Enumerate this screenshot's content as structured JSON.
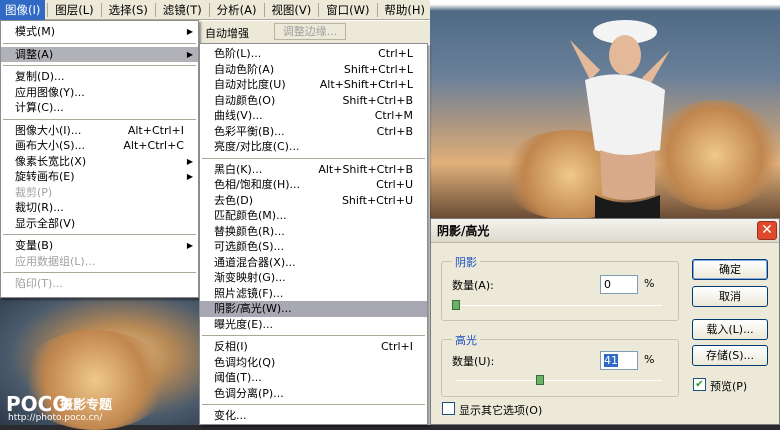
{
  "menubar": {
    "items": [
      "图像(I)",
      "图层(L)",
      "选择(S)",
      "滤镜(T)",
      "分析(A)",
      "视图(V)",
      "窗口(W)",
      "帮助(H)"
    ]
  },
  "image_menu": {
    "items": [
      {
        "label": "模式(M)",
        "shortcut": "",
        "sub": true
      },
      {
        "label": "调整(A)",
        "shortcut": "",
        "sub": true
      },
      {
        "label": "复制(D)...",
        "shortcut": ""
      },
      {
        "label": "应用图像(Y)...",
        "shortcut": ""
      },
      {
        "label": "计算(C)...",
        "shortcut": ""
      },
      {
        "label": "图像大小(I)...",
        "shortcut": "Alt+Ctrl+I"
      },
      {
        "label": "画布大小(S)...",
        "shortcut": "Alt+Ctrl+C"
      },
      {
        "label": "像素长宽比(X)",
        "shortcut": "",
        "sub": true
      },
      {
        "label": "旋转画布(E)",
        "shortcut": "",
        "sub": true
      },
      {
        "label": "裁剪(P)",
        "shortcut": ""
      },
      {
        "label": "裁切(R)...",
        "shortcut": ""
      },
      {
        "label": "显示全部(V)",
        "shortcut": ""
      },
      {
        "label": "变量(B)",
        "shortcut": "",
        "sub": true
      },
      {
        "label": "应用数据组(L)...",
        "shortcut": ""
      },
      {
        "label": "陷印(T)...",
        "shortcut": ""
      }
    ]
  },
  "toolbar": {
    "auto_enhance": "自动增强",
    "refine_edge": "调整边缘..."
  },
  "adjust_menu": {
    "items": [
      {
        "label": "色阶(L)...",
        "shortcut": "Ctrl+L"
      },
      {
        "label": "自动色阶(A)",
        "shortcut": "Shift+Ctrl+L"
      },
      {
        "label": "自动对比度(U)",
        "shortcut": "Alt+Shift+Ctrl+L"
      },
      {
        "label": "自动颜色(O)",
        "shortcut": "Shift+Ctrl+B"
      },
      {
        "label": "曲线(V)...",
        "shortcut": "Ctrl+M"
      },
      {
        "label": "色彩平衡(B)...",
        "shortcut": "Ctrl+B"
      },
      {
        "label": "亮度/对比度(C)...",
        "shortcut": ""
      },
      {
        "label": "黑白(K)...",
        "shortcut": "Alt+Shift+Ctrl+B"
      },
      {
        "label": "色相/饱和度(H)...",
        "shortcut": "Ctrl+U"
      },
      {
        "label": "去色(D)",
        "shortcut": "Shift+Ctrl+U"
      },
      {
        "label": "匹配颜色(M)...",
        "shortcut": ""
      },
      {
        "label": "替换颜色(R)...",
        "shortcut": ""
      },
      {
        "label": "可选颜色(S)...",
        "shortcut": ""
      },
      {
        "label": "通道混合器(X)...",
        "shortcut": ""
      },
      {
        "label": "渐变映射(G)...",
        "shortcut": ""
      },
      {
        "label": "照片滤镜(F)...",
        "shortcut": ""
      },
      {
        "label": "阴影/高光(W)...",
        "shortcut": ""
      },
      {
        "label": "曝光度(E)...",
        "shortcut": ""
      },
      {
        "label": "反相(I)",
        "shortcut": "Ctrl+I"
      },
      {
        "label": "色调均化(Q)",
        "shortcut": ""
      },
      {
        "label": "阈值(T)...",
        "shortcut": ""
      },
      {
        "label": "色调分离(P)...",
        "shortcut": ""
      },
      {
        "label": "变化...",
        "shortcut": ""
      }
    ]
  },
  "dialog": {
    "title": "阴影/高光",
    "shadows": {
      "legend": "阴影",
      "amount_label": "数量(A):",
      "amount": "0",
      "unit": "%",
      "level": 0
    },
    "highlights": {
      "legend": "高光",
      "amount_label": "数量(U):",
      "amount": "41",
      "unit": "%",
      "level": 41
    },
    "buttons": {
      "ok": "确定",
      "cancel": "取消",
      "load": "载入(L)...",
      "save": "存储(S)..."
    },
    "preview_label": "预览(P)",
    "show_more_label": "显示其它选项(O)"
  },
  "watermark": {
    "brand": "POCO",
    "tagline": "摄影专题",
    "url": "http://photo.poco.cn/"
  }
}
